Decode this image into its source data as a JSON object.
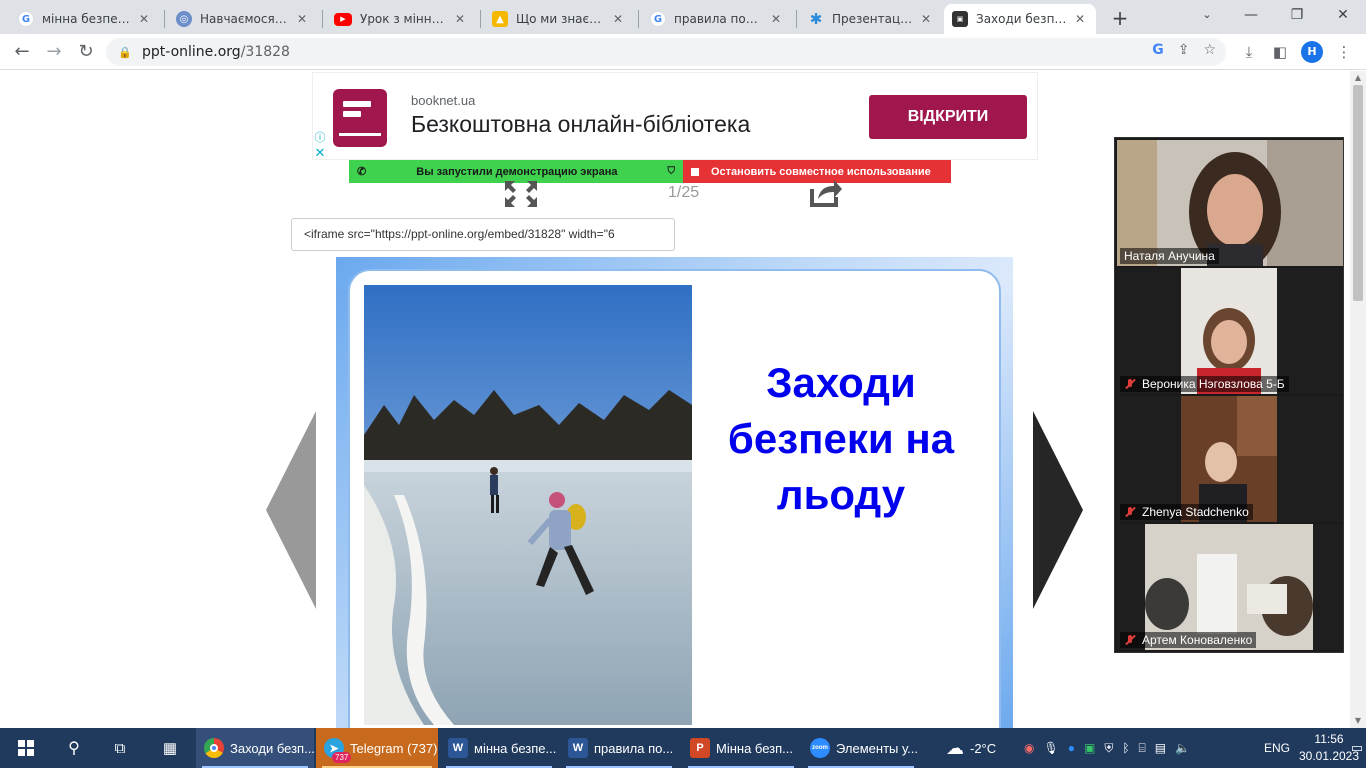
{
  "browser": {
    "tabs": [
      {
        "label": "мінна безпека пр",
        "icon": "google-icon",
        "active": false
      },
      {
        "label": "Навчаємося мінн",
        "icon": "globe-icon",
        "active": false
      },
      {
        "label": "Урок з мінної бе",
        "icon": "youtube-icon",
        "active": false
      },
      {
        "label": "Що ми знаємо п",
        "icon": "bookmark-icon",
        "active": false
      },
      {
        "label": "правила поведін",
        "icon": "google-icon",
        "active": false
      },
      {
        "label": "Презентація до",
        "icon": "star-icon",
        "active": false
      },
      {
        "label": "Заходи безпеки",
        "icon": "ppt-online-icon",
        "active": true
      }
    ],
    "new_tab": "+",
    "url_host": "ppt-online.org",
    "url_path": "/31828",
    "profile_initial": "H"
  },
  "ad": {
    "domain": "booknet.ua",
    "title": "Безкоштовна онлайн-бібліотека",
    "button": "ВІДКРИТИ",
    "info": "ⓘ",
    "close": "✕",
    "brand_color": "#a0174e"
  },
  "screen_share": {
    "status": "Вы запустили демонстрацию экрана",
    "stop": "Остановить совместное использование",
    "green": "#3ed24e",
    "red": "#e63234"
  },
  "viewer": {
    "counter": "1/25",
    "embed_code": "<iframe src=\"https://ppt-online.org/embed/31828\" width=\"6"
  },
  "slide": {
    "title": "Заходи безпеки на льоду",
    "title_color": "#0000ee"
  },
  "zoom": {
    "participants": [
      {
        "name": "Наталя Анучина",
        "muted": false,
        "active": false
      },
      {
        "name": "Вероника Нэговзлова 5-Б",
        "muted": true,
        "active": true
      },
      {
        "name": "Zhenya Stadchenko",
        "muted": true,
        "active": false
      },
      {
        "name": "Артем Коноваленко",
        "muted": true,
        "active": false
      }
    ]
  },
  "taskbar": {
    "apps": [
      {
        "label": "Заходи безп...",
        "icon": "chrome-icon"
      },
      {
        "label": "Telegram (737)",
        "icon": "telegram-icon",
        "badge": "737"
      },
      {
        "label": "мінна безпе...",
        "icon": "word-icon"
      },
      {
        "label": "правила по...",
        "icon": "word-icon"
      },
      {
        "label": "Мінна безп...",
        "icon": "powerpoint-icon"
      },
      {
        "label": "Элементы у...",
        "icon": "zoom-icon"
      }
    ],
    "weather": "-2°C",
    "language": "ENG",
    "time": "11:56",
    "date": "30.01.2023"
  }
}
